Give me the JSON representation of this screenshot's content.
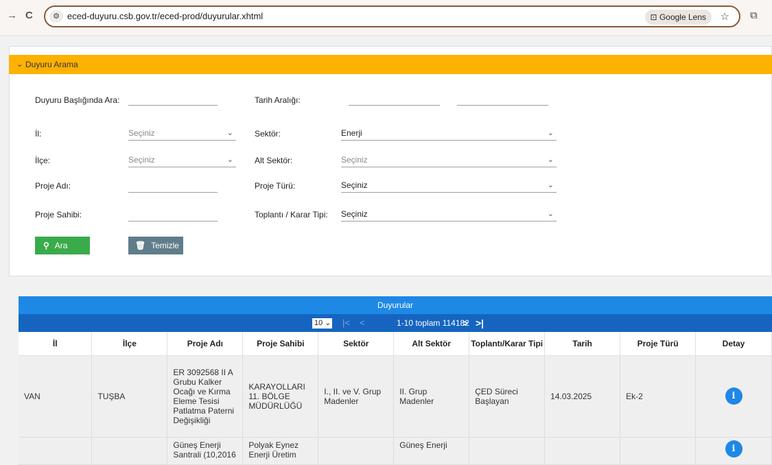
{
  "browser": {
    "back_icon": "→",
    "reload_icon": "C",
    "site_icon": "⚙",
    "url": "eced-duyuru.csb.gov.tr/eced-prod/duyurular.xhtml",
    "lens_label": "Google Lens",
    "star_icon": "☆",
    "ext_icon": "⧉"
  },
  "search": {
    "header": "Duyuru Arama",
    "title_label": "Duyuru Başlığında Ara:",
    "date_label": "Tarih Aralığı:",
    "il_label": "İl:",
    "il_value": "Seçiniz",
    "sektor_label": "Sektör:",
    "sektor_value": "Enerji",
    "ilce_label": "İlçe:",
    "ilce_value": "Seçiniz",
    "alt_sektor_label": "Alt Sektör:",
    "alt_sektor_value": "Seçiniz",
    "proje_adi_label": "Proje Adı:",
    "proje_turu_label": "Proje Türü:",
    "proje_turu_value": "Seçiniz",
    "proje_sahibi_label": "Proje Sahibi:",
    "toplanti_label": "Toplantı / Karar Tipi:",
    "toplanti_value": "Seçiniz",
    "search_button": "Ara",
    "clear_button": "Temizle"
  },
  "results": {
    "title": "Duyurular",
    "page_size": "10",
    "pager_text": "1-10 toplam 114182",
    "columns": [
      "İl",
      "İlçe",
      "Proje Adı",
      "Proje Sahibi",
      "Sektör",
      "Alt Sektör",
      "Toplantı/Karar Tipi",
      "Tarih",
      "Proje Türü",
      "Detay"
    ],
    "rows": [
      {
        "il": "VAN",
        "ilce": "TUŞBA",
        "proje_adi": "ER 3092568 II A Grubu Kalker Ocağı ve Kırma Eleme Tesisi Patlatma Paterni Değişikliği",
        "proje_sahibi": "KARAYOLLARI 11. BÖLGE MÜDÜRLÜĞÜ",
        "sektor": "I., II. ve V. Grup Madenler",
        "alt_sektor": "II. Grup Madenler",
        "toplanti": "ÇED Süreci Başlayan",
        "tarih": "14.03.2025",
        "proje_turu": "Ek-2"
      },
      {
        "il": "",
        "ilce": "",
        "proje_adi": "Güneş Enerji Santrali (10,2016",
        "proje_sahibi": "Polyak Eynez Enerji Üretim",
        "sektor": "",
        "alt_sektor": "Güneş Enerji",
        "toplanti": "",
        "tarih": "",
        "proje_turu": ""
      }
    ]
  }
}
